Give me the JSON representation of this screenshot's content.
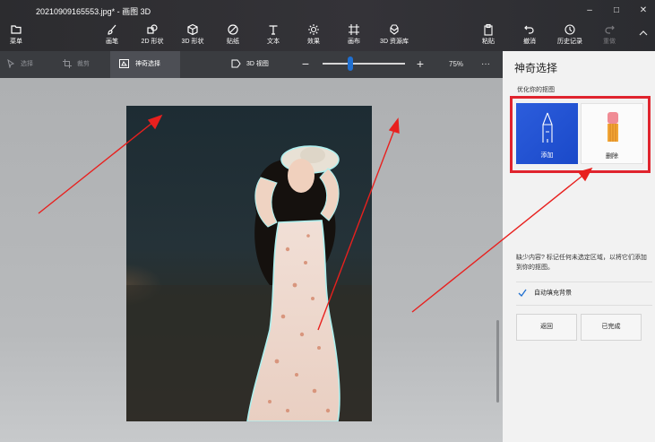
{
  "window": {
    "title": "20210909165553.jpg* - 画图 3D",
    "controls": {
      "minimize": "–",
      "maximize": "□",
      "close": "✕"
    }
  },
  "ribbon": {
    "menu_label": "菜单",
    "items": [
      {
        "label": "画笔",
        "icon": "brush-icon"
      },
      {
        "label": "2D 形状",
        "icon": "2d-shapes-icon"
      },
      {
        "label": "3D 形状",
        "icon": "3d-shapes-icon"
      },
      {
        "label": "贴纸",
        "icon": "stickers-icon"
      },
      {
        "label": "文本",
        "icon": "text-icon"
      },
      {
        "label": "效果",
        "icon": "effects-icon"
      },
      {
        "label": "画布",
        "icon": "canvas-icon"
      },
      {
        "label": "3D 资源库",
        "icon": "3d-library-icon"
      }
    ],
    "right_items": [
      {
        "label": "粘贴",
        "icon": "paste-icon"
      },
      {
        "label": "撤消",
        "icon": "undo-icon"
      },
      {
        "label": "历史记录",
        "icon": "history-icon"
      },
      {
        "label": "重做",
        "icon": "redo-icon"
      }
    ]
  },
  "toolbar": {
    "select_label": "选择",
    "crop_label": "裁剪",
    "magic_select_label": "神奇选择",
    "view3d_label": "3D 视图",
    "zoom_minus": "−",
    "zoom_plus": "+",
    "zoom_percent": "75%",
    "zoom_slider_fraction": 0.34,
    "more_label": "···"
  },
  "panel": {
    "title": "神奇选择",
    "subtitle": "优化你的抠图",
    "add_label": "添加",
    "remove_label": "删除",
    "hint": "缺少内容? 标记任何未选定区域，以将它们添加到你的抠图。",
    "autofill_label": "自动填充背景",
    "autofill_checked": true,
    "back_label": "返回",
    "done_label": "已完成"
  },
  "colors": {
    "accent": "#1F6FD0",
    "add_button": "#1A49C9",
    "highlight_box": "#E0242E",
    "arrow": "#E8201E"
  }
}
